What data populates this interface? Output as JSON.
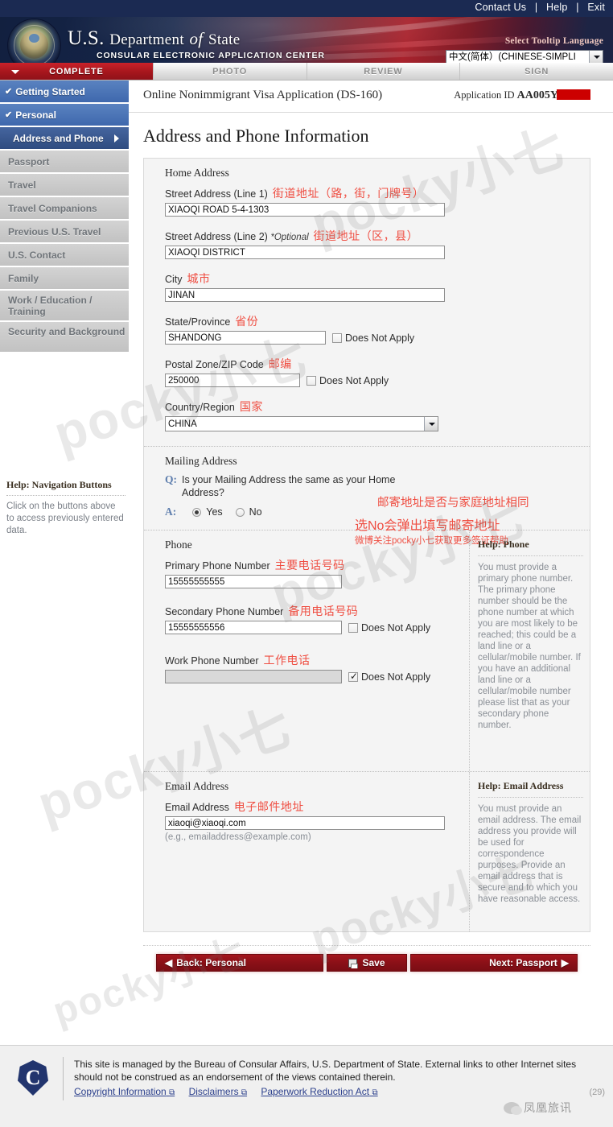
{
  "topbar": {
    "contact": "Contact Us",
    "help": "Help",
    "exit": "Exit"
  },
  "banner": {
    "title_us": "U.S.",
    "title_dept": "Department",
    "title_of": "of",
    "title_state": "State",
    "subtitle": "CONSULAR ELECTRONIC APPLICATION CENTER",
    "tooltip_label": "Select Tooltip Language",
    "language_value": "中文(简体）(CHINESE-SIMPLI"
  },
  "tabs": [
    {
      "label": "COMPLETE",
      "active": true
    },
    {
      "label": "PHOTO",
      "active": false
    },
    {
      "label": "REVIEW",
      "active": false
    },
    {
      "label": "SIGN",
      "active": false
    }
  ],
  "sidebar": {
    "items": [
      {
        "label": "Getting Started",
        "state": "done"
      },
      {
        "label": "Personal",
        "state": "done"
      },
      {
        "label": "Address and Phone",
        "state": "current"
      },
      {
        "label": "Passport",
        "state": "locked"
      },
      {
        "label": "Travel",
        "state": "locked"
      },
      {
        "label": "Travel Companions",
        "state": "locked"
      },
      {
        "label": "Previous U.S. Travel",
        "state": "locked"
      },
      {
        "label": "U.S. Contact",
        "state": "locked"
      },
      {
        "label": "Family",
        "state": "locked"
      },
      {
        "label": "Work / Education / Training",
        "state": "locked"
      },
      {
        "label": "Security and Background",
        "state": "locked"
      }
    ],
    "help_title": "Help: Navigation Buttons",
    "help_body": "Click on the buttons above to access previously entered data."
  },
  "appbar": {
    "form_title": "Online Nonimmigrant Visa Application (DS-160)",
    "application_id_label": "Application ID",
    "application_id_value": "AA005Y"
  },
  "page_title": "Address and Phone Information",
  "home_address": {
    "section_title": "Home Address",
    "street1_label": "Street Address (Line 1)",
    "street1_cn": "街道地址（路，街，门牌号）",
    "street1_value": "XIAOQI ROAD 5-4-1303",
    "street2_label": "Street Address (Line 2)",
    "street2_optional": "*Optional",
    "street2_cn": "街道地址（区，县）",
    "street2_value": "XIAOQI DISTRICT",
    "city_label": "City",
    "city_cn": "城市",
    "city_value": "JINAN",
    "state_label": "State/Province",
    "state_cn": "省份",
    "state_value": "SHANDONG",
    "state_dna": "Does Not Apply",
    "state_dna_checked": false,
    "postal_label": "Postal Zone/ZIP Code",
    "postal_cn": "邮编",
    "postal_value": "250000",
    "postal_dna": "Does Not Apply",
    "postal_dna_checked": false,
    "country_label": "Country/Region",
    "country_cn": "国家",
    "country_value": "CHINA"
  },
  "mailing_address": {
    "section_title": "Mailing Address",
    "q_mark": "Q:",
    "a_mark": "A:",
    "question": "Is your Mailing Address the same as your Home Address?",
    "yes_label": "Yes",
    "no_label": "No",
    "selected": "Yes",
    "anno_1": "邮寄地址是否与家庭地址相同",
    "anno_2": "选No会弹出填写邮寄地址",
    "anno_3": "微博关注pocky小七获取更多签证帮助"
  },
  "phone": {
    "section_title": "Phone",
    "primary_label": "Primary Phone Number",
    "primary_cn": "主要电话号码",
    "primary_value": "15555555555",
    "secondary_label": "Secondary Phone Number",
    "secondary_cn": "备用电话号码",
    "secondary_value": "15555555556",
    "secondary_dna": "Does Not Apply",
    "secondary_dna_checked": false,
    "work_label": "Work Phone Number",
    "work_cn": "工作电话",
    "work_value": "",
    "work_dna": "Does Not Apply",
    "work_dna_checked": true,
    "help_title": "Help: Phone",
    "help_body": "You must provide a primary phone number. The primary phone number should be the phone number at which you are most likely to be reached; this could be a land line or a cellular/mobile number. If you have an additional land line or a cellular/mobile number please list that as your secondary phone number."
  },
  "email": {
    "section_title": "Email Address",
    "field_label": "Email Address",
    "field_cn": "电子邮件地址",
    "value": "xiaoqi@xiaoqi.com",
    "hint": "(e.g., emailaddress@example.com)",
    "help_title": "Help: Email Address",
    "help_body": "You must provide an email address.  The email address you provide will be used for correspondence purposes.  Provide an email address that is secure and to which you have reasonable access."
  },
  "nav_buttons": {
    "back": "Back: Personal",
    "back_arrow": "◀",
    "save": "Save",
    "next": "Next: Passport",
    "next_arrow": "▶"
  },
  "footer": {
    "seal_letter": "C",
    "text": "This site is managed by the Bureau of Consular Affairs, U.S. Department of State. External links to other Internet sites should not be construed as an endorsement of the views contained therein.",
    "link_copyright": "Copyright Information",
    "link_disclaimers": "Disclaimers",
    "link_paperwork": "Paperwork Reduction Act",
    "ext_glyph": "⧉",
    "wechat_text": "凤凰旅讯",
    "count": "(29)"
  },
  "watermarks": {
    "main": "pocky小七"
  },
  "colors": {
    "navy": "#1b2a52",
    "red": "#a6161d",
    "annotation_red": "#ef4e42",
    "nav_blue": "#3f68ad",
    "link_blue": "#2b3f8c"
  }
}
